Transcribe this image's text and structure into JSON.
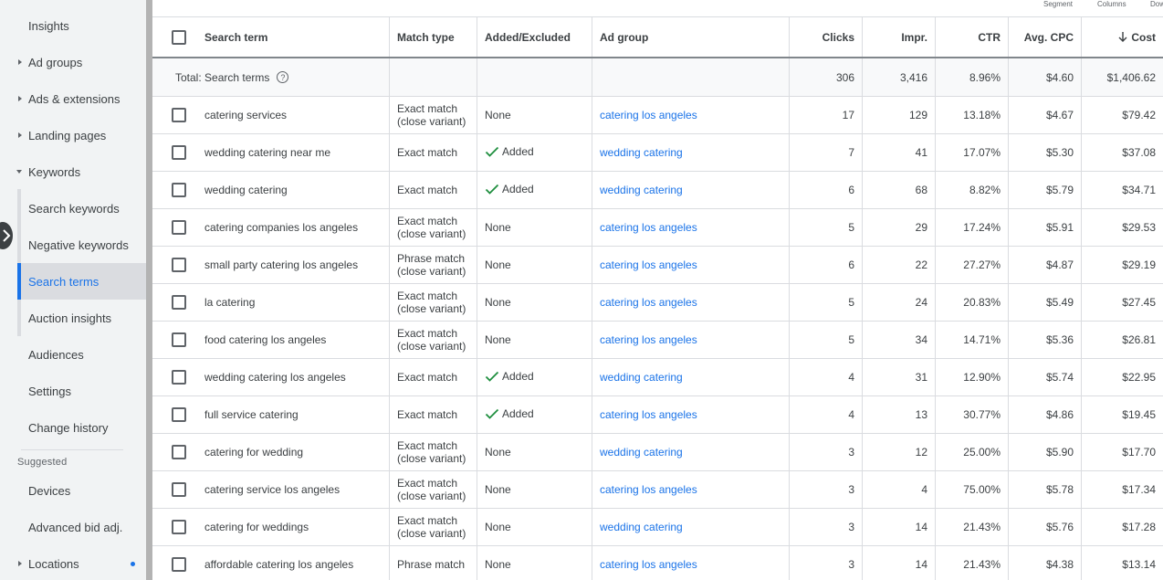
{
  "sidebar": {
    "items": [
      {
        "label": "Insights",
        "caret": "none"
      },
      {
        "label": "Ad groups",
        "caret": "right"
      },
      {
        "label": "Ads & extensions",
        "caret": "right"
      },
      {
        "label": "Landing pages",
        "caret": "right"
      },
      {
        "label": "Keywords",
        "caret": "down"
      },
      {
        "label": "Search keywords",
        "caret": "none"
      },
      {
        "label": "Negative keywords",
        "caret": "none"
      },
      {
        "label": "Search terms",
        "caret": "none",
        "active": true
      },
      {
        "label": "Auction insights",
        "caret": "none"
      },
      {
        "label": "Audiences",
        "caret": "none"
      },
      {
        "label": "Settings",
        "caret": "none"
      },
      {
        "label": "Change history",
        "caret": "none"
      }
    ],
    "suggested_label": "Suggested",
    "suggested_items": [
      {
        "label": "Devices",
        "caret": "none"
      },
      {
        "label": "Advanced bid adj.",
        "caret": "none"
      },
      {
        "label": "Locations",
        "caret": "right",
        "dot": true
      }
    ]
  },
  "toolbar": {
    "segment": "Segment",
    "columns": "Columns",
    "download": "Dow"
  },
  "table": {
    "headers": {
      "search_term": "Search term",
      "match_type": "Match type",
      "added_excluded": "Added/Excluded",
      "ad_group": "Ad group",
      "clicks": "Clicks",
      "impr": "Impr.",
      "ctr": "CTR",
      "avg_cpc": "Avg. CPC",
      "cost": "Cost"
    },
    "sort": {
      "column": "cost",
      "direction": "descending"
    },
    "total": {
      "label": "Total: Search terms",
      "clicks": "306",
      "impr": "3,416",
      "ctr": "8.96%",
      "avg_cpc": "$4.60",
      "cost": "$1,406.62"
    },
    "rows": [
      {
        "term": "catering services",
        "match": "Exact match (close variant)",
        "added": "None",
        "group": "catering los angeles",
        "clicks": "17",
        "impr": "129",
        "ctr": "13.18%",
        "cpc": "$4.67",
        "cost": "$79.42"
      },
      {
        "term": "wedding catering near me",
        "match": "Exact match",
        "added": "Added",
        "group": "wedding catering",
        "clicks": "7",
        "impr": "41",
        "ctr": "17.07%",
        "cpc": "$5.30",
        "cost": "$37.08"
      },
      {
        "term": "wedding catering",
        "match": "Exact match",
        "added": "Added",
        "group": "wedding catering",
        "clicks": "6",
        "impr": "68",
        "ctr": "8.82%",
        "cpc": "$5.79",
        "cost": "$34.71"
      },
      {
        "term": "catering companies los angeles",
        "match": "Exact match (close variant)",
        "added": "None",
        "group": "catering los angeles",
        "clicks": "5",
        "impr": "29",
        "ctr": "17.24%",
        "cpc": "$5.91",
        "cost": "$29.53"
      },
      {
        "term": "small party catering los angeles",
        "match": "Phrase match (close variant)",
        "added": "None",
        "group": "catering los angeles",
        "clicks": "6",
        "impr": "22",
        "ctr": "27.27%",
        "cpc": "$4.87",
        "cost": "$29.19"
      },
      {
        "term": "la catering",
        "match": "Exact match (close variant)",
        "added": "None",
        "group": "catering los angeles",
        "clicks": "5",
        "impr": "24",
        "ctr": "20.83%",
        "cpc": "$5.49",
        "cost": "$27.45"
      },
      {
        "term": "food catering los angeles",
        "match": "Exact match (close variant)",
        "added": "None",
        "group": "catering los angeles",
        "clicks": "5",
        "impr": "34",
        "ctr": "14.71%",
        "cpc": "$5.36",
        "cost": "$26.81"
      },
      {
        "term": "wedding catering los angeles",
        "match": "Exact match",
        "added": "Added",
        "group": "wedding catering",
        "clicks": "4",
        "impr": "31",
        "ctr": "12.90%",
        "cpc": "$5.74",
        "cost": "$22.95"
      },
      {
        "term": "full service catering",
        "match": "Exact match",
        "added": "Added",
        "group": "catering los angeles",
        "clicks": "4",
        "impr": "13",
        "ctr": "30.77%",
        "cpc": "$4.86",
        "cost": "$19.45"
      },
      {
        "term": "catering for wedding",
        "match": "Exact match (close variant)",
        "added": "None",
        "group": "wedding catering",
        "clicks": "3",
        "impr": "12",
        "ctr": "25.00%",
        "cpc": "$5.90",
        "cost": "$17.70"
      },
      {
        "term": "catering service los angeles",
        "match": "Exact match (close variant)",
        "added": "None",
        "group": "catering los angeles",
        "clicks": "3",
        "impr": "4",
        "ctr": "75.00%",
        "cpc": "$5.78",
        "cost": "$17.34"
      },
      {
        "term": "catering for weddings",
        "match": "Exact match (close variant)",
        "added": "None",
        "group": "wedding catering",
        "clicks": "3",
        "impr": "14",
        "ctr": "21.43%",
        "cpc": "$5.76",
        "cost": "$17.28"
      },
      {
        "term": "affordable catering los angeles",
        "match": "Phrase match",
        "added": "None",
        "group": "catering los angeles",
        "clicks": "3",
        "impr": "14",
        "ctr": "21.43%",
        "cpc": "$4.38",
        "cost": "$13.14"
      }
    ]
  },
  "colors": {
    "accent": "#1a73e8",
    "added_check": "#1e8e3e",
    "sidebar_bg": "#f1f3f4"
  }
}
